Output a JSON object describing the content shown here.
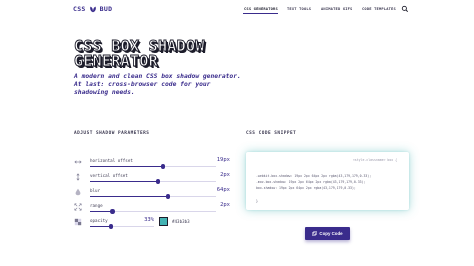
{
  "header": {
    "logo_left": "CSS",
    "logo_right": "BUD",
    "nav": [
      "CSS GENERATORS",
      "TEXT TOOLS",
      "ANIMATED GIFS",
      "CODE TEMPLATES"
    ],
    "active_nav": "CSS GENERATORS"
  },
  "hero": {
    "title": "CSS Box Shadow Generator",
    "subtitle": "A modern and clean CSS box shadow generator. At last: cross-browser code for your shadowing needs."
  },
  "params": {
    "section_title": "ADJUST SHADOW PARAMETERS",
    "rows": [
      {
        "label": "horizontal offset",
        "value": "19px",
        "fraction": 0.58,
        "icon": "horizontal-arrows-icon"
      },
      {
        "label": "vertical offset",
        "value": "2px",
        "fraction": 0.54,
        "icon": "vertical-arrows-icon"
      },
      {
        "label": "blur",
        "value": "64px",
        "fraction": 0.62,
        "icon": "droplet-icon"
      },
      {
        "label": "range",
        "value": "2px",
        "fraction": 0.18,
        "icon": "expand-icon"
      },
      {
        "label": "opacity",
        "value": "33%",
        "fraction": 0.33,
        "icon": "checker-icon"
      }
    ],
    "color_hex": "#43b3b3"
  },
  "code": {
    "section_title": "CSS CODE SNIPPET",
    "tag": "<style.classname> box {",
    "lines": [
      "-webkit-box-shadow: 19px 2px 64px 2px rgba(43,179,179,0.33);",
      "-moz-box-shadow: 19px 2px 64px 2px rgba(43,179,179,0.33);",
      "box-shadow: 19px 2px 64px 2px rgba(43,179,179,0.33);",
      "}"
    ],
    "copy_label": "Copy Code"
  },
  "colors": {
    "accent": "#3a2c8c",
    "teal": "#43b3b3"
  }
}
